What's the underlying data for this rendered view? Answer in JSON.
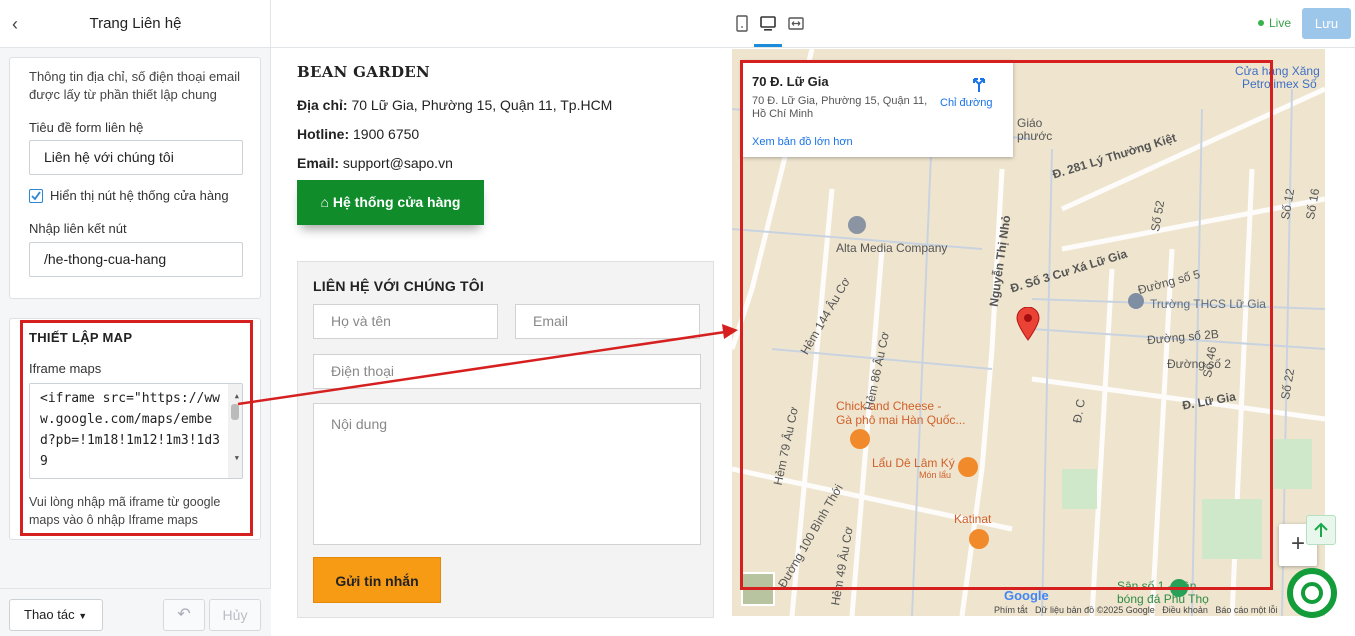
{
  "sidebar": {
    "back_icon": "chevron-left-icon",
    "title": "Trang Liên hệ",
    "info_note": "Thông tin địa chỉ, số điện thoại email được lấy từ phần thiết lập chung",
    "form_title_label": "Tiêu đề form liên hệ",
    "form_title_value": "Liên hệ với chúng tôi",
    "show_store_checkbox_label": "Hiển thị nút hệ thống cửa hàng",
    "show_store_checked": true,
    "link_label": "Nhập liên kết nút",
    "link_value": "/he-thong-cua-hang",
    "map_section_title": "THIẾT LẬP MAP",
    "iframe_label": "Iframe maps",
    "iframe_value": "<iframe src=\"https://www.google.com/maps/embed?pb=!1m18!1m12!1m3!1d39",
    "map_hint": "Vui lòng nhập mã iframe từ google maps vào ô nhập Iframe maps",
    "footer": {
      "action_label": "Thao tác",
      "undo_icon": "undo-icon",
      "cancel_label": "Hủy"
    }
  },
  "topbar": {
    "devices": [
      "mobile-icon",
      "desktop-icon",
      "fullwidth-icon"
    ],
    "active_device": "desktop-icon",
    "live_label": "Live",
    "save_label": "Lưu"
  },
  "preview": {
    "store_name": "BEAN GARDEN",
    "address_label": "Địa chỉ:",
    "address_value": "70 Lữ Gia, Phường 15, Quận 11, Tp.HCM",
    "hotline_label": "Hotline:",
    "hotline_value": "1900 6750",
    "email_label": "Email:",
    "email_value": "support@sapo.vn",
    "store_button": "Hệ thống cửa hàng",
    "contact_form": {
      "title": "LIÊN HỆ VỚI CHÚNG TÔI",
      "name_placeholder": "Họ và tên",
      "email_placeholder": "Email",
      "phone_placeholder": "Điện thoại",
      "message_placeholder": "Nội dung",
      "submit_label": "Gửi tin nhắn"
    }
  },
  "map": {
    "place_title": "70 Đ. Lữ Gia",
    "place_address": "70 Đ. Lữ Gia, Phường 15, Quận 11, Hồ Chí Minh",
    "directions_label": "Chỉ đường",
    "larger_map_label": "Xem bản đồ lớn hơn",
    "labels": [
      "Cửa hàng Xăng",
      "Petrolimex Số",
      "Giáo",
      "phước",
      "Đ. 281 Lý Thường Kiệt",
      "Số 52",
      "Đ. Số 3 Cư Xá Lữ Gia",
      "Alta Media Company",
      "Nguyễn Thị Nhỏ",
      "Đường số 5",
      "Trường THCS Lữ Gia",
      "Đường số 2B",
      "Đường số 2",
      "Hẻm 144 Âu Cơ",
      "Hẻm 86 Âu Cơ",
      "Đ. Lữ Gia",
      "Chick and Cheese -",
      "Gà phô mai Hàn Quốc...",
      "Lẩu Dê Lâm Ký",
      "Món lẩu",
      "Hẻm 79 Âu Cơ",
      "Katinat",
      "Đường 100 Bình Thới",
      "Hẻm 49 Âu Cơ",
      "Sân số 1 - Sân",
      "bóng đá Phú Thọ",
      "Đ. C",
      "Số 46",
      "Số 22",
      "Số 12",
      "Số 16"
    ],
    "attribution": [
      "Phím tắt",
      "Dữ liệu bản đồ ©2025 Google",
      "Điều khoản",
      "Báo cáo một lỗi"
    ],
    "zoom_in": "+",
    "logo": "Google"
  },
  "floating": {
    "scroll_top_icon": "arrow-up-icon",
    "chat_icon": "chat-icon"
  },
  "colors": {
    "accent": "#1a8cd8",
    "store_button": "#108c2b",
    "submit_button": "#f79a14",
    "annotation": "#d62020"
  }
}
